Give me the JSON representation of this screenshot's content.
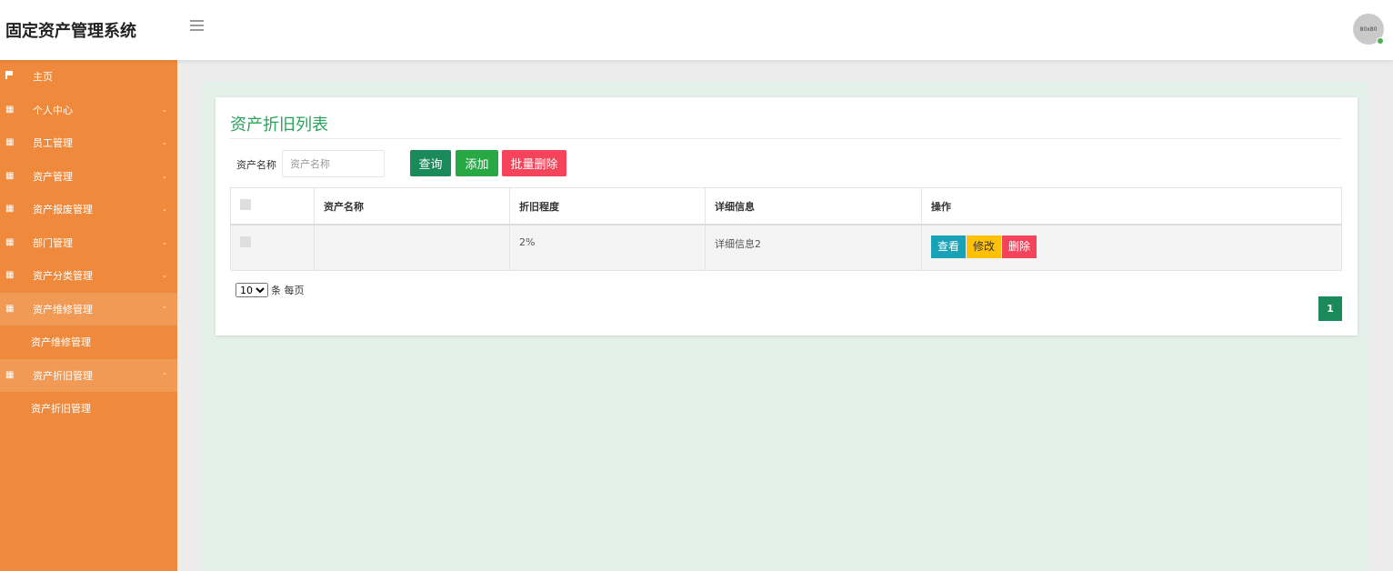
{
  "app": {
    "title": "固定资产管理系统",
    "avatar_text": "80x80"
  },
  "colors": {
    "sidebar": "#ef8a3c",
    "sidebar_active": "#f19a55",
    "accent_green": "#28a35a",
    "main_bg": "#e4f1ea"
  },
  "sidebar": {
    "items": [
      {
        "label": "主页",
        "icon": "flag-icon"
      },
      {
        "label": "个人中心",
        "icon": "grid-icon",
        "caret": "⌄"
      },
      {
        "label": "员工管理",
        "icon": "grid-icon",
        "caret": "⌄"
      },
      {
        "label": "资产管理",
        "icon": "grid-icon",
        "caret": "⌄"
      },
      {
        "label": "资产报废管理",
        "icon": "grid-icon",
        "caret": "⌄"
      },
      {
        "label": "部门管理",
        "icon": "grid-icon",
        "caret": "⌄"
      },
      {
        "label": "资产分类管理",
        "icon": "grid-icon",
        "caret": "⌄"
      },
      {
        "label": "资产维修管理",
        "icon": "grid-icon",
        "caret": "⌃"
      },
      {
        "label": "资产维修管理",
        "sub": true
      },
      {
        "label": "资产折旧管理",
        "icon": "grid-icon",
        "caret": "⌃"
      },
      {
        "label": "资产折旧管理",
        "sub": true
      }
    ]
  },
  "main": {
    "title": "资产折旧列表",
    "search": {
      "label": "资产名称",
      "placeholder": "资产名称",
      "value": ""
    },
    "buttons": {
      "query": "查询",
      "add": "添加",
      "batch_delete": "批量删除"
    },
    "table": {
      "headers": [
        "",
        "资产名称",
        "折旧程度",
        "详细信息",
        "操作"
      ],
      "rows": [
        {
          "name": "",
          "depreciation": "2%",
          "detail": "详细信息2",
          "actions": {
            "view": "查看",
            "edit": "修改",
            "delete": "删除"
          }
        }
      ]
    },
    "pagination": {
      "page_size": "10",
      "page_size_suffix": "条 每页",
      "current_page": "1"
    }
  }
}
